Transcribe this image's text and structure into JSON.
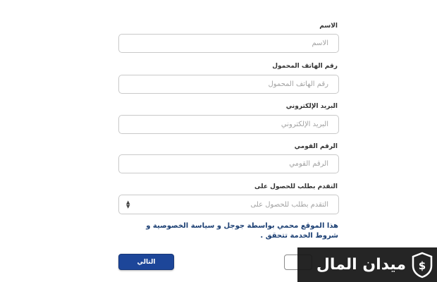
{
  "form": {
    "name": {
      "label": "الاسم",
      "placeholder": "الاسم",
      "value": ""
    },
    "phone": {
      "label": "رقم الهاتف المحمول",
      "placeholder": "رقم الهاتف المحمول",
      "value": ""
    },
    "email": {
      "label": "البريد الإلكتروني",
      "placeholder": "البريد الإلكتروني",
      "value": ""
    },
    "national_id": {
      "label": "الرقم القومي",
      "placeholder": "الرقم القومي",
      "value": ""
    },
    "request": {
      "label": "التقدم بطلب للحصول على",
      "selected": "التقدم بطلب للحصول على"
    }
  },
  "notice": "هذا الموقع محمي بواسطة جوجل و سياسة الخصوصية و شروط الخدمة تتحقق .",
  "buttons": {
    "next_label": "التالي",
    "prev_label": ""
  },
  "watermark": {
    "text": "ميدان المال",
    "logo_icon": "shield-dollar-icon"
  },
  "colors": {
    "accent": "#1d4699",
    "notice_text": "#1b3f73",
    "input_border": "#c9c9c9"
  }
}
